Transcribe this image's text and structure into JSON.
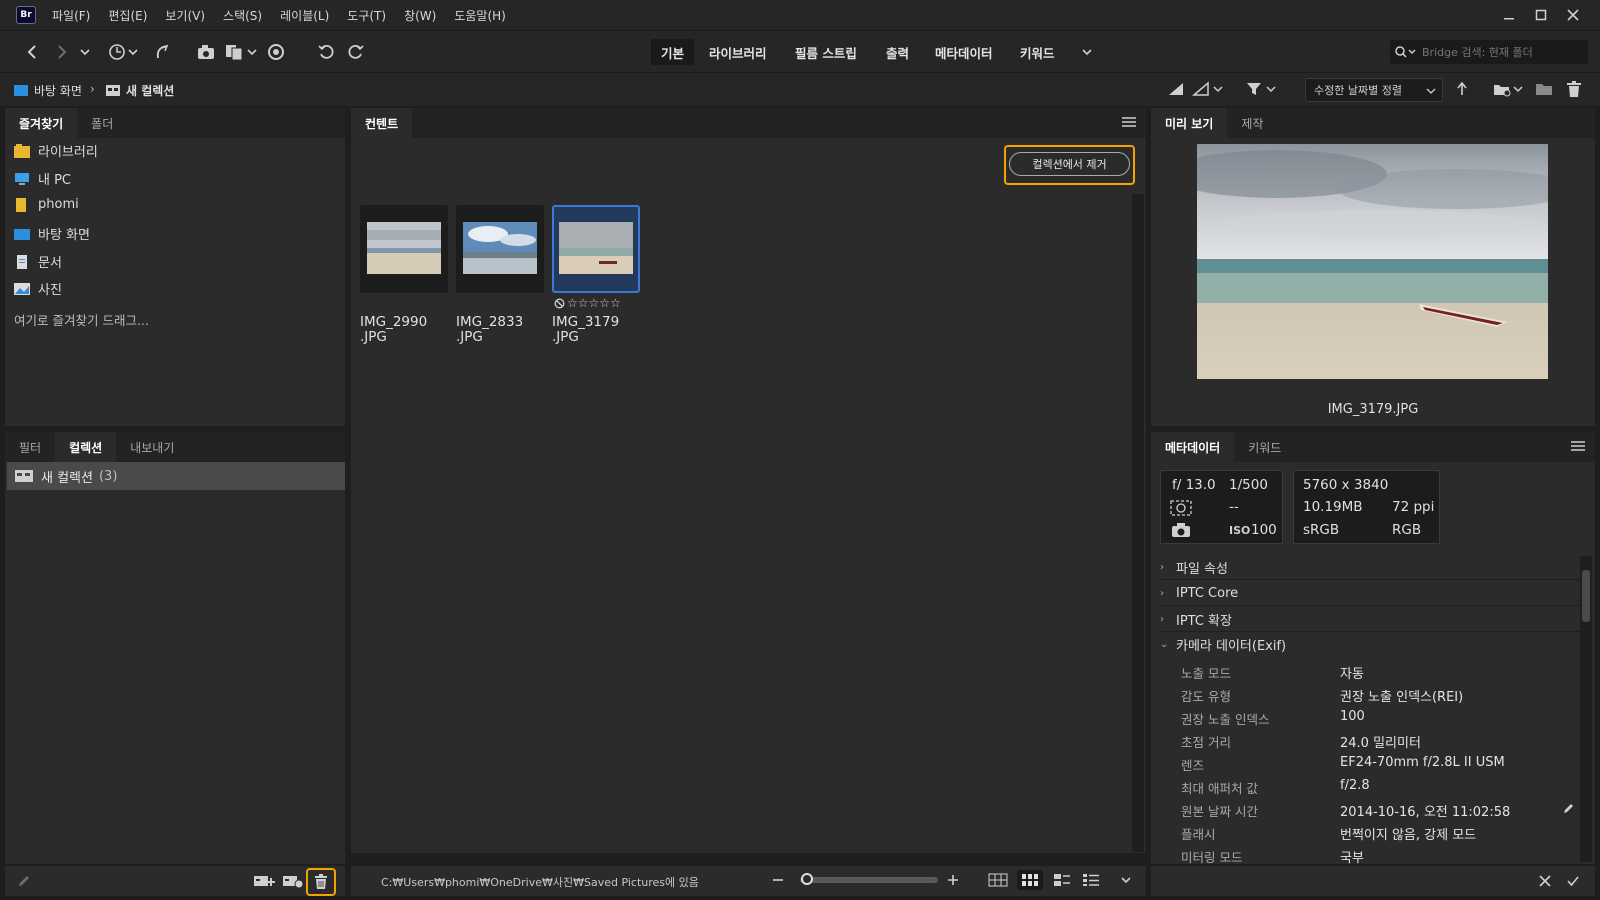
{
  "app": {
    "logo_text": "Br"
  },
  "menu": [
    "파일(F)",
    "편집(E)",
    "보기(V)",
    "스택(S)",
    "레이블(L)",
    "도구(T)",
    "창(W)",
    "도움말(H)"
  ],
  "workspaces": [
    "기본",
    "라이브러리",
    "필름 스트립",
    "출력",
    "메타데이터",
    "키워드"
  ],
  "active_workspace": "기본",
  "search": {
    "placeholder": "Bridge 검색: 현재 폴더"
  },
  "breadcrumb": [
    "바탕 화면",
    "새 컬렉션"
  ],
  "sort": {
    "selected": "수정한 날짜별 정렬"
  },
  "favorites_panel": {
    "tabs": [
      "즐겨찾기",
      "폴더"
    ],
    "items": [
      "라이브러리",
      "내 PC",
      "phomi",
      "바탕 화면",
      "문서",
      "사진"
    ],
    "drop_hint": "여기로 즐겨찾기 드래그..."
  },
  "collections_panel": {
    "tabs": [
      "필터",
      "컬렉션",
      "내보내기"
    ],
    "items": [
      {
        "label": "새 컬렉션",
        "count": "(3)"
      }
    ]
  },
  "content_panel": {
    "tab": "컨텐트",
    "remove_button": "컬렉션에서 제거",
    "thumbnails": [
      {
        "name_line1": "IMG_2990",
        "name_line2": ".JPG",
        "selected": false
      },
      {
        "name_line1": "IMG_2833",
        "name_line2": ".JPG",
        "selected": false
      },
      {
        "name_line1": "IMG_3179",
        "name_line2": ".JPG",
        "selected": true,
        "rating": 0
      }
    ],
    "status_path": "C:₩Users₩phomi₩OneDrive₩사진₩Saved Pictures에 있음"
  },
  "preview_panel": {
    "tabs": [
      "미리 보기",
      "제작"
    ],
    "filename": "IMG_3179.JPG"
  },
  "metadata_panel": {
    "tabs": [
      "메타데이터",
      "키워드"
    ],
    "aperture": "f/ 13.0",
    "shutter": "1/500",
    "metering": "--",
    "iso_label": "ISO",
    "iso": "100",
    "dimensions": "5760 x 3840",
    "filesize": "10.19MB",
    "resolution": "72 ppi",
    "colorspace": "sRGB",
    "colormode": "RGB",
    "sections": [
      "파일 속성",
      "IPTC Core",
      "IPTC 확장",
      "카메라 데이터(Exif)"
    ],
    "exif": [
      {
        "key": "노출 모드",
        "value": "자동"
      },
      {
        "key": "감도 유형",
        "value": "권장 노출 인덱스(REI)"
      },
      {
        "key": "권장 노출 인덱스",
        "value": "100"
      },
      {
        "key": "초점 거리",
        "value": "24.0 밀리미터"
      },
      {
        "key": "렌즈",
        "value": "EF24-70mm f/2.8L II USM"
      },
      {
        "key": "최대 애퍼처 값",
        "value": "f/2.8"
      },
      {
        "key": "원본 날짜 시간",
        "value": "2014-10-16, 오전 11:02:58"
      },
      {
        "key": "플래시",
        "value": "번쩍이지 않음, 강제 모드"
      },
      {
        "key": "미터링 모드",
        "value": "국부"
      }
    ]
  },
  "colors": {
    "highlight": "#f5a300",
    "selection": "#3c78d8"
  }
}
